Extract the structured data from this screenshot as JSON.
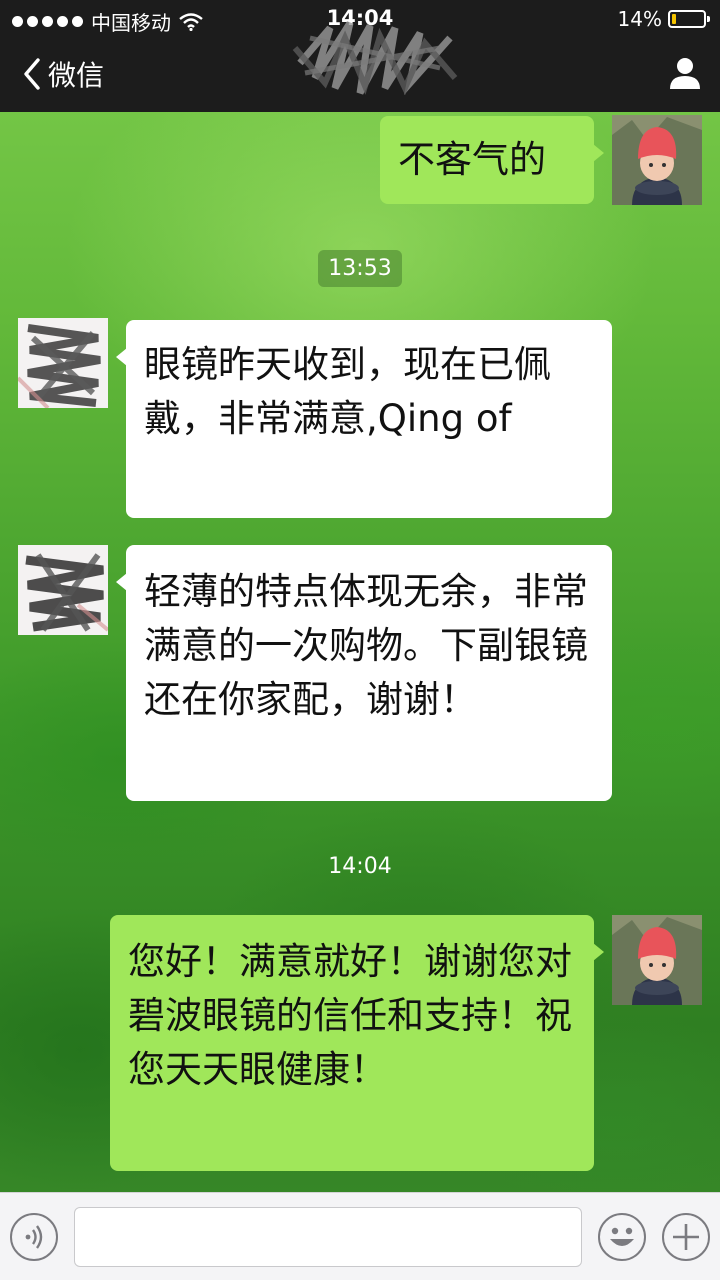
{
  "status_bar": {
    "carrier": "中国移动",
    "time": "14:04",
    "battery_percent": "14%",
    "battery_level": 0.14
  },
  "nav": {
    "back_label": "微信"
  },
  "messages": [
    {
      "direction": "out",
      "text": "不客气的"
    },
    {
      "type": "time",
      "text": "13:53"
    },
    {
      "direction": "in",
      "text": "眼镜昨天收到，现在已佩戴，非常满意,Qing of"
    },
    {
      "direction": "in",
      "text": "轻薄的特点体现无余，非常满意的一次购物。下副银镜还在你家配，谢谢！"
    },
    {
      "type": "time",
      "text": "14:04"
    },
    {
      "direction": "out",
      "text": "您好！满意就好！谢谢您对碧波眼镜的信任和支持！祝您天天眼健康！"
    }
  ],
  "colors": {
    "outgoing_bubble": "#a0e75a",
    "incoming_bubble": "#ffffff",
    "top_bar": "#1c1c1c",
    "battery_fill": "#f5c400"
  },
  "icons": [
    "signal-dots-icon",
    "wifi-icon",
    "battery-icon",
    "back-chevron-icon",
    "person-icon",
    "voice-icon",
    "emoji-icon",
    "plus-icon"
  ]
}
